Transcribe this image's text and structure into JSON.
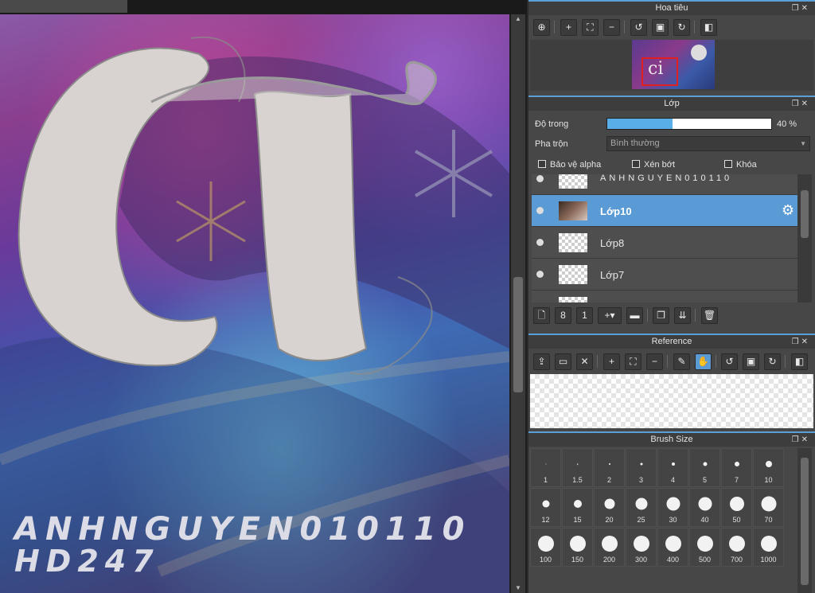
{
  "canvas": {
    "watermark_line1": "ANHNGUYEN010110",
    "watermark_line2": "HD247",
    "letters": "ci"
  },
  "navigator": {
    "title": "Hoa tiêu",
    "tools": [
      "zoom-fit-icon",
      "zoom-in-icon",
      "fit-window-icon",
      "zoom-out-icon",
      "rotate-left-icon",
      "reset-icon",
      "rotate-right-icon",
      "flip-icon"
    ],
    "preview_letters": "ci"
  },
  "layers": {
    "title": "Lớp",
    "opacity_label": "Độ trong",
    "opacity_value": 40,
    "opacity_text": "40 %",
    "blend_label": "Pha trộn",
    "blend_value": "Bình thường",
    "protect_alpha": "Bảo vệ alpha",
    "clipping": "Xén bớt",
    "lock": "Khóa",
    "items": [
      {
        "name": "ANHNGUYEN010110",
        "selected": false
      },
      {
        "name": "Lớp10",
        "selected": true
      },
      {
        "name": "Lớp8",
        "selected": false
      },
      {
        "name": "Lớp7",
        "selected": false
      }
    ],
    "actions": [
      "new-layer-icon",
      "new-layer-8bit-icon",
      "new-layer-1bit-icon",
      "add-layer-dropdown-icon",
      "new-folder-icon",
      "duplicate-icon",
      "merge-down-icon",
      "delete-icon"
    ]
  },
  "reference": {
    "title": "Reference",
    "tools": [
      "upload-icon",
      "open-folder-icon",
      "close-icon",
      "zoom-in-icon",
      "fit-window-icon",
      "zoom-out-icon",
      "eyedropper-icon",
      "hand-icon",
      "rotate-left-icon",
      "reset-icon",
      "rotate-right-icon",
      "flip-icon"
    ]
  },
  "brush_size": {
    "title": "Brush Size",
    "sizes": [
      "1",
      "1.5",
      "2",
      "3",
      "4",
      "5",
      "7",
      "10",
      "12",
      "15",
      "20",
      "25",
      "30",
      "40",
      "50",
      "70",
      "100",
      "150",
      "200",
      "300",
      "400",
      "500",
      "700",
      "1000"
    ]
  },
  "colors": {
    "accent": "#5b9bd5",
    "panel_bg": "#474747",
    "opacity_fill": "#5aaee8",
    "nav_frame": "#e02020"
  }
}
